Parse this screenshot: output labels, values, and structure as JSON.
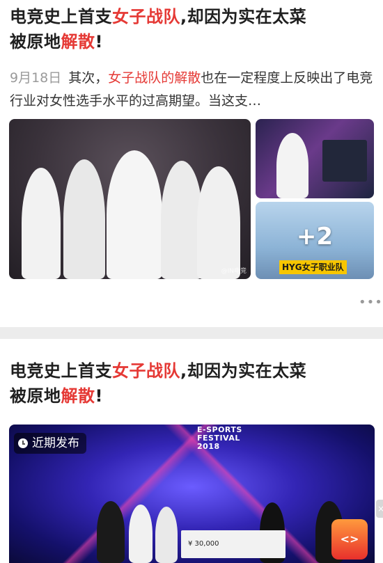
{
  "results": [
    {
      "title_parts": {
        "a": "电竞史上首支",
        "b": "女子战队",
        "c": ",却因为实在太菜",
        "d": "被原地",
        "e": "解散",
        "f": "!"
      },
      "snippet": {
        "date": "9月18日",
        "a": "其次，",
        "b": "女子战队的解散",
        "c": "也在一定程度上反映出了电竞行业对女性选手水平的过高期望。当这支…"
      },
      "image_main_watermark": "@IN电竞",
      "image_gallery_more": "+2",
      "image_gallery_caption": "HYG女子职业队",
      "more_menu": "•••"
    },
    {
      "title_parts": {
        "a": "电竞史上首支",
        "b": "女子战队",
        "c": ",却因为实在太菜",
        "d": "被原地",
        "e": "解散",
        "f": "!"
      },
      "badge": "近期发布",
      "event_sign": "E-SPORTS FESTIVAL 2018",
      "cheque": "¥ 30,000",
      "gift_icon": "red-envelope-icon",
      "close_icon": "close-icon"
    }
  ],
  "colors": {
    "highlight": "#e53935",
    "date": "#9a9a9a",
    "badge_caption": "#f7c600"
  }
}
